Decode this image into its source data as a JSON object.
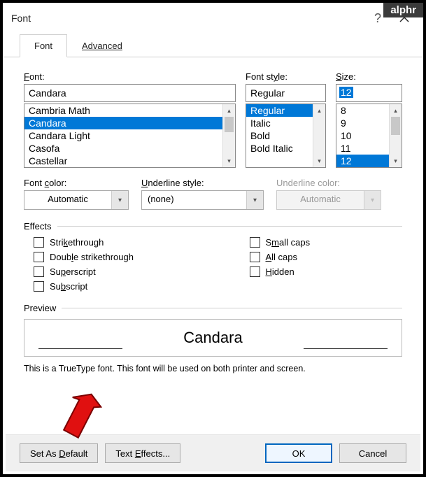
{
  "watermark": "alphr",
  "window": {
    "title": "Font"
  },
  "tabs": {
    "font": "Font",
    "advanced": "Advanced"
  },
  "labels": {
    "font": "Font:",
    "font_u": "F",
    "style": "Font style:",
    "style_u": "y",
    "size": "Size:",
    "size_u": "S",
    "color": "Font color:",
    "color_u": "c",
    "ustyle": "Underline style:",
    "ustyle_u": "U",
    "ucolor": "Underline color:",
    "ucolor_u": "c",
    "effects": "Effects",
    "preview": "Preview"
  },
  "font": {
    "value": "Candara",
    "list": [
      "Cambria Math",
      "Candara",
      "Candara Light",
      "Casofa",
      "Castellar"
    ],
    "selected_index": 1
  },
  "style": {
    "value": "Regular",
    "list": [
      "Regular",
      "Italic",
      "Bold",
      "Bold Italic"
    ],
    "selected_index": 0
  },
  "size": {
    "value": "12",
    "list": [
      "8",
      "9",
      "10",
      "11",
      "12"
    ],
    "selected_index": 4
  },
  "color": {
    "value": "Automatic"
  },
  "ustyle": {
    "value": "(none)"
  },
  "ucolor": {
    "value": "Automatic"
  },
  "effects": {
    "strike": "Strikethrough",
    "strike_u": "k",
    "dstrike": "Double strikethrough",
    "dstrike_u": "l",
    "super": "Superscript",
    "super_u": "p",
    "sub": "Subscript",
    "sub_u": "b",
    "smallcaps": "Small caps",
    "smallcaps_u": "m",
    "allcaps": "All caps",
    "allcaps_u": "A",
    "hidden": "Hidden",
    "hidden_u": "H"
  },
  "preview": {
    "text": "Candara"
  },
  "note": "This is a TrueType font. This font will be used on both printer and screen.",
  "buttons": {
    "default": "Set As Default",
    "default_u": "D",
    "effects": "Text Effects...",
    "effects_u": "E",
    "ok": "OK",
    "cancel": "Cancel"
  }
}
